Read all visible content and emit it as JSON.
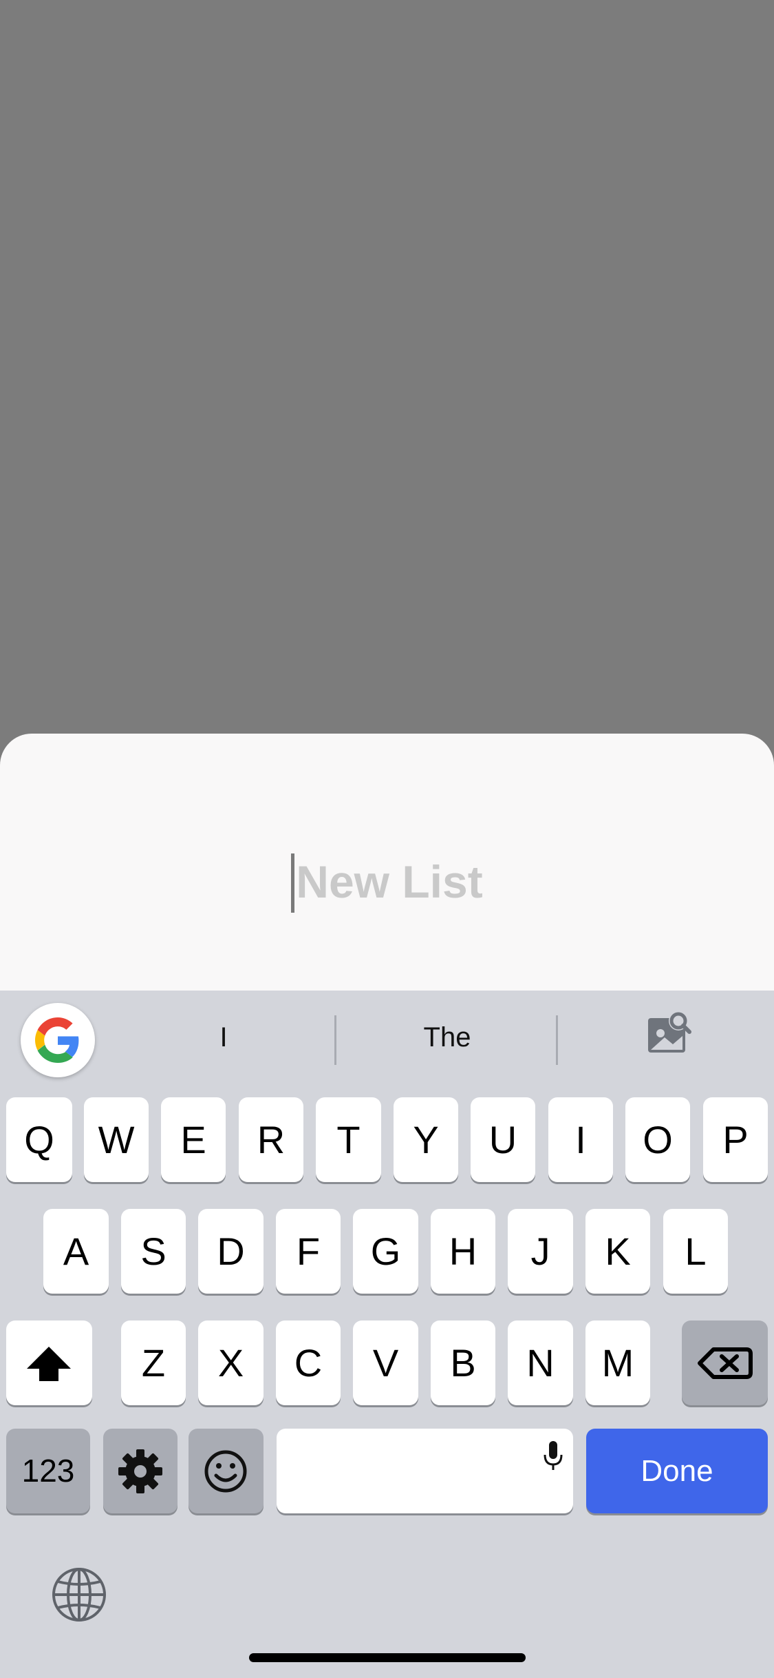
{
  "sheet": {
    "title_placeholder": "New List"
  },
  "keyboard": {
    "suggestions": [
      "I",
      "The"
    ],
    "row1": [
      "Q",
      "W",
      "E",
      "R",
      "T",
      "Y",
      "U",
      "I",
      "O",
      "P"
    ],
    "row2": [
      "A",
      "S",
      "D",
      "F",
      "G",
      "H",
      "J",
      "K",
      "L"
    ],
    "row3": [
      "Z",
      "X",
      "C",
      "V",
      "B",
      "N",
      "M"
    ],
    "numbers_label": "123",
    "done_label": "Done"
  },
  "colors": {
    "done_button": "#3f66ea",
    "keyboard_bg": "#d3d5db",
    "backdrop": "#7c7c7c"
  },
  "icons": {
    "google": "google-g-icon",
    "lens": "image-search-icon",
    "shift": "shift-arrow-icon",
    "backspace": "backspace-icon",
    "settings": "gear-icon",
    "emoji": "smiley-icon",
    "mic": "microphone-icon",
    "globe": "globe-icon"
  }
}
